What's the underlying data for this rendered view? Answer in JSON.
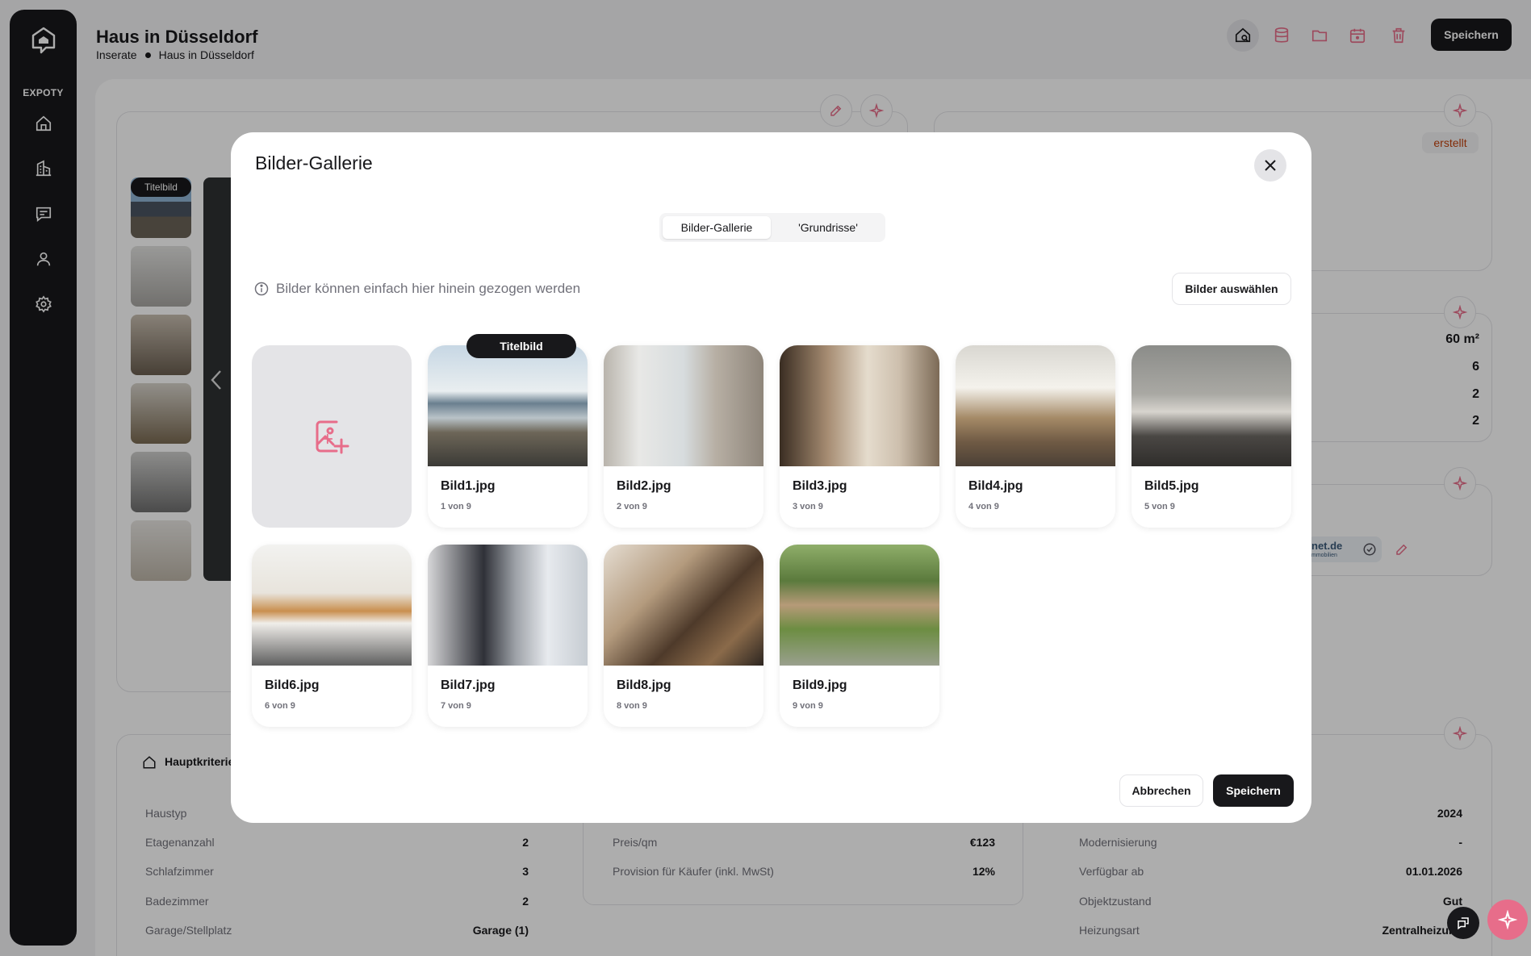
{
  "app": {
    "brand": "EXPOTY",
    "nav": [
      {
        "name": "home-icon"
      },
      {
        "name": "building-icon"
      },
      {
        "name": "message-icon"
      },
      {
        "name": "user-icon"
      },
      {
        "name": "gear-icon"
      }
    ]
  },
  "header": {
    "title": "Haus in Düsseldorf",
    "breadcrumb": [
      "Inserate",
      "Haus in Düsseldorf"
    ],
    "icons": [
      "house-search-icon",
      "database-icon",
      "folder-icon",
      "calendar-icon",
      "trash-icon"
    ],
    "save_label": "Speichern"
  },
  "background": {
    "title_badge": "Titelbild",
    "status_badge": "erstellt",
    "stats": [
      "60 m²",
      "6",
      "2",
      "2"
    ],
    "portal_text": "net.de",
    "portal_sub": "mmobilien",
    "section_title": "Hauptkriterien",
    "left_rows": [
      {
        "k": "Haustyp",
        "v": ""
      },
      {
        "k": "Etagenanzahl",
        "v": "2"
      },
      {
        "k": "Schlafzimmer",
        "v": "3"
      },
      {
        "k": "Badezimmer",
        "v": "2"
      },
      {
        "k": "Garage/Stellplatz",
        "v": "Garage (1)"
      }
    ],
    "mid_rows": [
      {
        "k": "Preis/qm",
        "v": "€123"
      },
      {
        "k": "Provision für Käufer (inkl. MwSt)",
        "v": "12%"
      }
    ],
    "right_rows": [
      {
        "k": "",
        "v": "2024"
      },
      {
        "k": "Modernisierung",
        "v": "-"
      },
      {
        "k": "Verfügbar ab",
        "v": "01.01.2026"
      },
      {
        "k": "Objektzustand",
        "v": "Gut"
      },
      {
        "k": "Heizungsart",
        "v": "Zentralheizung"
      }
    ]
  },
  "modal": {
    "title": "Bilder-Gallerie",
    "tabs": [
      {
        "label": "Bilder-Gallerie",
        "active": true
      },
      {
        "label": "'Grundrisse'",
        "active": false
      }
    ],
    "hint": "Bilder können einfach hier hinein gezogen werden",
    "choose_label": "Bilder auswählen",
    "title_badge": "Titelbild",
    "images": [
      {
        "name": "Bild1.jpg",
        "count": "1 von 9"
      },
      {
        "name": "Bild2.jpg",
        "count": "2 von 9"
      },
      {
        "name": "Bild3.jpg",
        "count": "3 von 9"
      },
      {
        "name": "Bild4.jpg",
        "count": "4 von 9"
      },
      {
        "name": "Bild5.jpg",
        "count": "5 von 9"
      },
      {
        "name": "Bild6.jpg",
        "count": "6 von 9"
      },
      {
        "name": "Bild7.jpg",
        "count": "7 von 9"
      },
      {
        "name": "Bild8.jpg",
        "count": "8 von 9"
      },
      {
        "name": "Bild9.jpg",
        "count": "9 von 9"
      }
    ],
    "cancel_label": "Abbrechen",
    "save_label": "Speichern"
  },
  "colors": {
    "accent": "#e76d8a",
    "dark": "#18181b"
  }
}
